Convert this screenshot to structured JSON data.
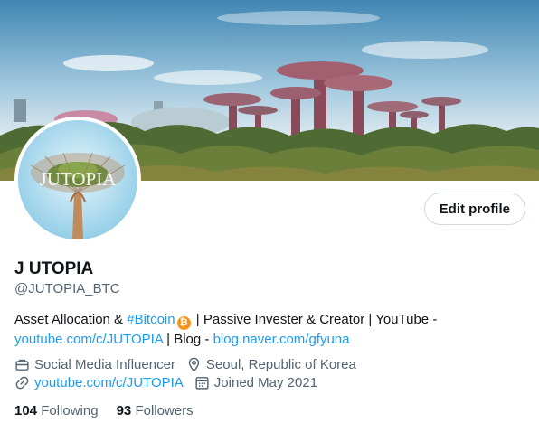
{
  "header": {
    "banner_image": "gardens-by-the-bay-supertrees-photo"
  },
  "avatar": {
    "image": "supertree-logo",
    "overlay_text": "JUTOPIA"
  },
  "actions": {
    "edit_profile_label": "Edit profile"
  },
  "profile": {
    "display_name": "J UTOPIA",
    "handle": "@JUTOPIA_BTC"
  },
  "bio": {
    "part1": "Asset Allocation & ",
    "hashtag": "#Bitcoin",
    "btc_icon": "bitcoin-icon",
    "btc_symbol": "₿",
    "part2": " | Passive Invester & Creator | YouTube -",
    "youtube_link": "youtube.com/c/JUTOPIA",
    "part3": " | Blog - ",
    "blog_link": "blog.naver.com/gfyuna"
  },
  "meta": {
    "category": "Social Media Influencer",
    "location": "Seoul, Republic of Korea",
    "website": "youtube.com/c/JUTOPIA",
    "joined": "Joined May 2021"
  },
  "stats": {
    "following_count": "104",
    "following_label": "Following",
    "followers_count": "93",
    "followers_label": "Followers"
  },
  "colors": {
    "accent": "#1d9bf0",
    "secondary_text": "#536471",
    "primary_text": "#0f1419",
    "bitcoin": "#f7931a"
  }
}
